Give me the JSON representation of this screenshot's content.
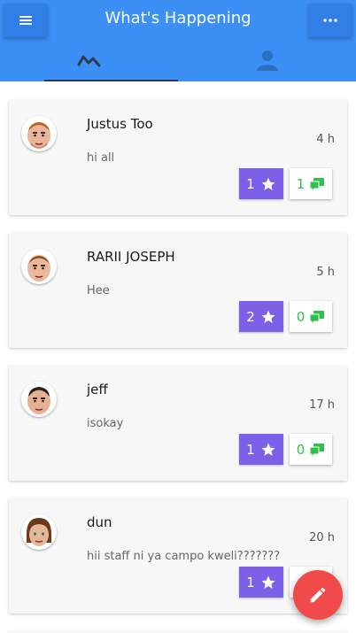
{
  "header": {
    "title": "What's Happening"
  },
  "icons": {
    "menu": "hamburger-icon",
    "more": "more-dots-icon",
    "activity": "activity-icon",
    "profile": "person-icon",
    "star": "star-icon",
    "comment": "comment-icon",
    "edit": "pencil-icon"
  },
  "colors": {
    "header": "#3b8ff5",
    "like_button": "#7e5fe8",
    "comment_count": "#2ec14a",
    "fab": "#f04a4a"
  },
  "posts": [
    {
      "name": "Justus Too",
      "time": "4 h",
      "message": "hi all",
      "likes": "1",
      "comments": "1"
    },
    {
      "name": "RARII JOSEPH",
      "time": "5 h",
      "message": "Hee",
      "likes": "2",
      "comments": "0"
    },
    {
      "name": "jeff",
      "time": "17 h",
      "message": "isokay",
      "likes": "1",
      "comments": "0"
    },
    {
      "name": "dun",
      "time": "20 h",
      "message": "hii staff ni ya campo kweli???????",
      "likes": "1",
      "comments": ""
    }
  ]
}
